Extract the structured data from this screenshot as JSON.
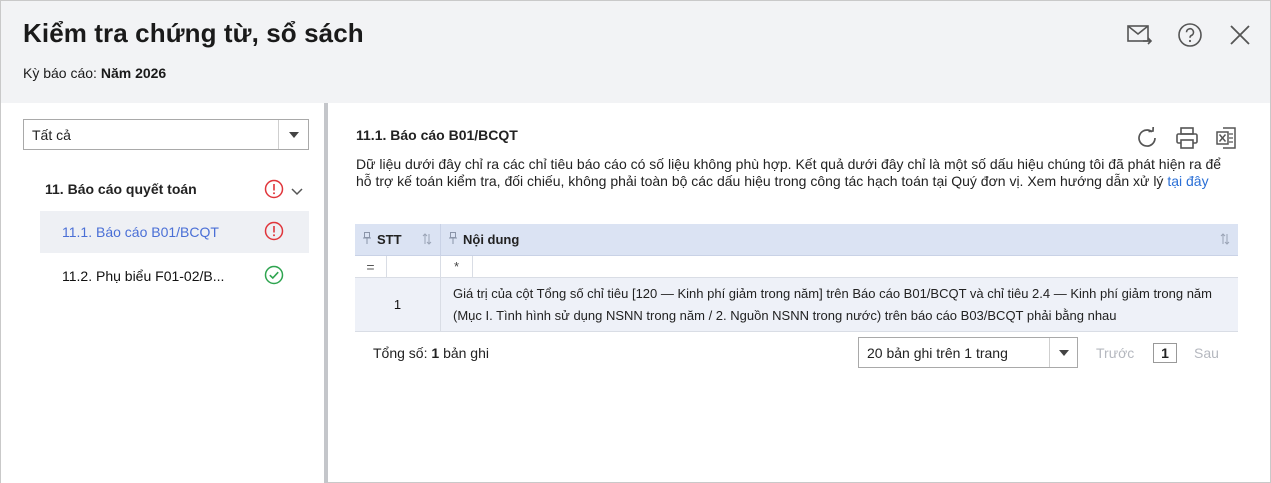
{
  "header": {
    "title": "Kiểm tra chứng từ, sổ sách",
    "period_label": "Kỳ báo cáo:",
    "period_value": "Năm 2026",
    "icons": [
      "send-mail-icon",
      "help-icon",
      "close-icon"
    ]
  },
  "filter": {
    "selected": "Tất cả"
  },
  "tree": {
    "group_label": "11. Báo cáo quyết toán",
    "items": [
      {
        "label": "11.1. Báo cáo B01/BCQT",
        "status": "warning"
      },
      {
        "label": "11.2. Phụ biểu F01-02/B...",
        "status": "ok"
      }
    ]
  },
  "section": {
    "title": "11.1. Báo cáo B01/BCQT",
    "description": "Dữ liệu dưới đây chỉ ra các chỉ tiêu báo cáo có số liệu không phù hợp. Kết quả dưới đây chỉ là một số dấu hiệu chúng tôi đã phát hiện ra để hỗ trợ kế toán kiểm tra, đối chiếu, không phải toàn bộ các dấu hiệu trong công tác hạch toán tại Quý đơn vị. Xem hướng dẫn xử lý",
    "link_text": "tại đây"
  },
  "grid": {
    "columns": [
      "STT",
      "Nội dung"
    ],
    "filter_ops": [
      "=",
      "*"
    ],
    "rows": [
      {
        "stt": "1",
        "content": "Giá trị của cột Tổng số chỉ tiêu [120 — Kinh phí giảm trong năm] trên Báo cáo B01/BCQT và chỉ tiêu 2.4 — Kinh phí giảm trong năm (Mục I. Tình hình sử dụng NSNN trong năm / 2. Nguồn NSNN trong nước) trên báo cáo B03/BCQT phải bằng nhau"
      }
    ]
  },
  "pager": {
    "total_label": "Tổng số:",
    "total_count": "1",
    "total_unit": "bản ghi",
    "page_size": "20 bản ghi trên 1 trang",
    "prev": "Trước",
    "page": "1",
    "next": "Sau"
  },
  "colors": {
    "warning": "#e0353b",
    "ok": "#2ea44f",
    "link": "#2a6fd6",
    "active_item": "#4a6fd6"
  }
}
